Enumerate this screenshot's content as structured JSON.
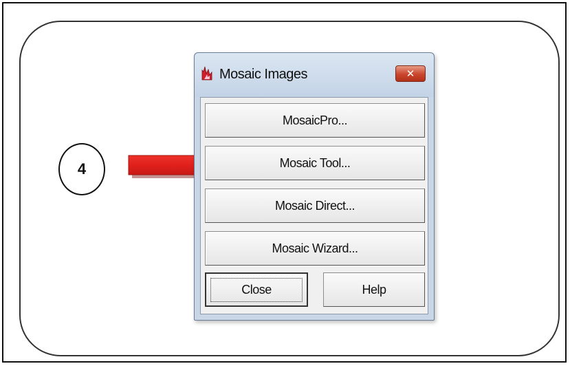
{
  "callout": {
    "step_number": "4"
  },
  "dialog": {
    "title": "Mosaic Images",
    "close_glyph": "✕",
    "buttons": {
      "mosaic_pro": "MosaicPro...",
      "mosaic_tool": "Mosaic Tool...",
      "mosaic_direct": "Mosaic Direct...",
      "mosaic_wizard": "Mosaic Wizard...",
      "close": "Close",
      "help": "Help"
    }
  },
  "colors": {
    "arrow": "#e0201c",
    "title_close_button": "#c9452b",
    "dialog_frame": "#c9d6e6"
  },
  "icons": {
    "title_icon": "mosaic-flame-icon",
    "callout_arrow": "red-arrow-icon"
  }
}
